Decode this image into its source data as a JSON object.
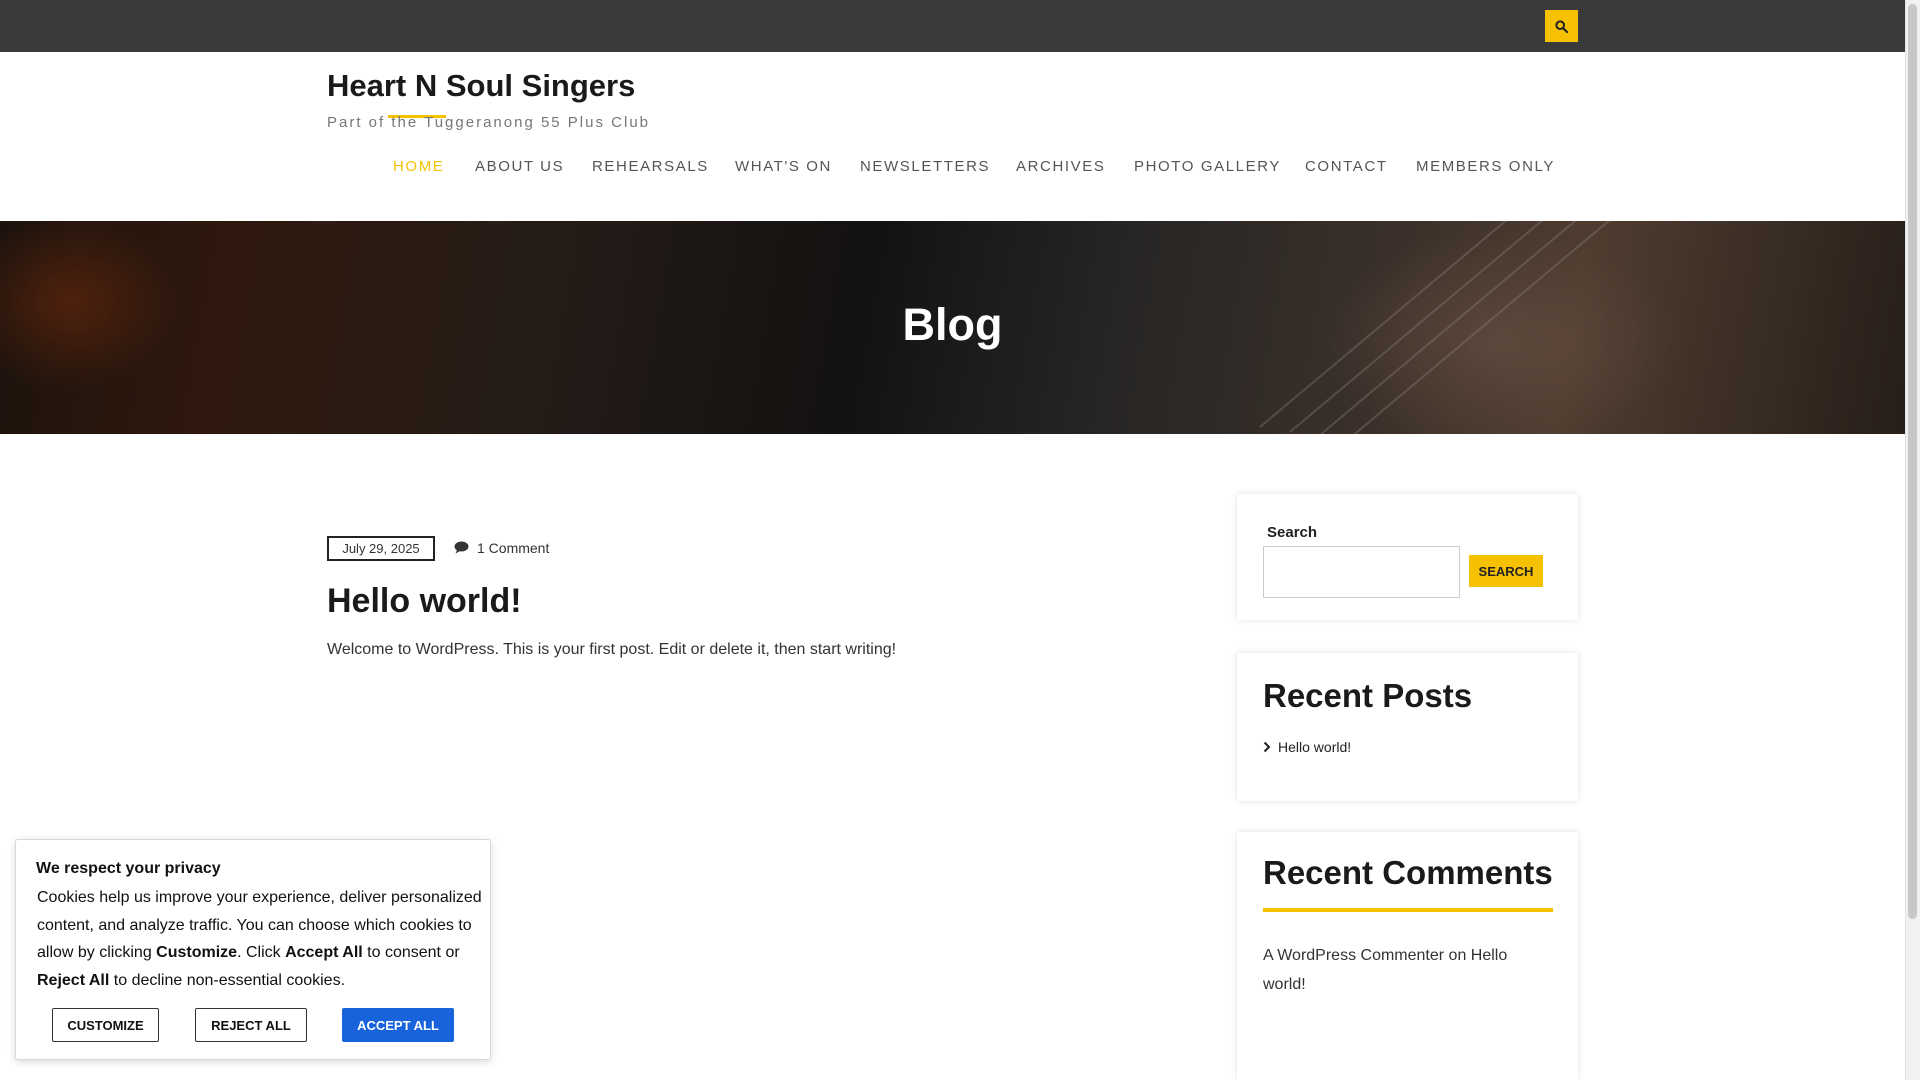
{
  "site": {
    "title": "Heart N Soul Singers",
    "tagline": "Part of the Tuggeranong 55 Plus Club"
  },
  "nav": {
    "items": [
      {
        "label": "HOME",
        "active": true
      },
      {
        "label": "ABOUT US"
      },
      {
        "label": "REHEARSALS"
      },
      {
        "label": "WHAT'S ON"
      },
      {
        "label": "NEWSLETTERS"
      },
      {
        "label": "ARCHIVES"
      },
      {
        "label": "PHOTO GALLERY"
      },
      {
        "label": "CONTACT"
      },
      {
        "label": "MEMBERS ONLY"
      }
    ]
  },
  "hero": {
    "title": "Blog"
  },
  "post": {
    "date": "July 29, 2025",
    "comments": "1 Comment",
    "title": "Hello world!",
    "excerpt": "Welcome to WordPress. This is your first post. Edit or delete it, then start writing!"
  },
  "sidebar": {
    "search": {
      "label": "Search",
      "value": "",
      "button": "SEARCH"
    },
    "recent_posts": {
      "title": "Recent Posts",
      "items": [
        "Hello world!"
      ]
    },
    "recent_comments": {
      "title": "Recent Comments",
      "author": "A WordPress Commenter",
      "connector": " on ",
      "post": "Hello world!"
    }
  },
  "cookie": {
    "title": "We respect your privacy",
    "text_1": "Cookies help us improve your experience, deliver personalized content, and analyze traffic. You can choose which cookies to allow by clicking ",
    "bold_customize": "Customize",
    "text_2": ". Click ",
    "bold_accept": "Accept All",
    "text_3": " to consent or ",
    "bold_reject": "Reject All",
    "text_4": " to decline non-essential cookies.",
    "buttons": {
      "customize": "CUSTOMIZE",
      "reject": "REJECT ALL",
      "accept": "ACCEPT ALL"
    }
  },
  "colors": {
    "accent": "#f5c100",
    "topbar": "#3a3a3a",
    "accept_button": "#1863dc"
  }
}
